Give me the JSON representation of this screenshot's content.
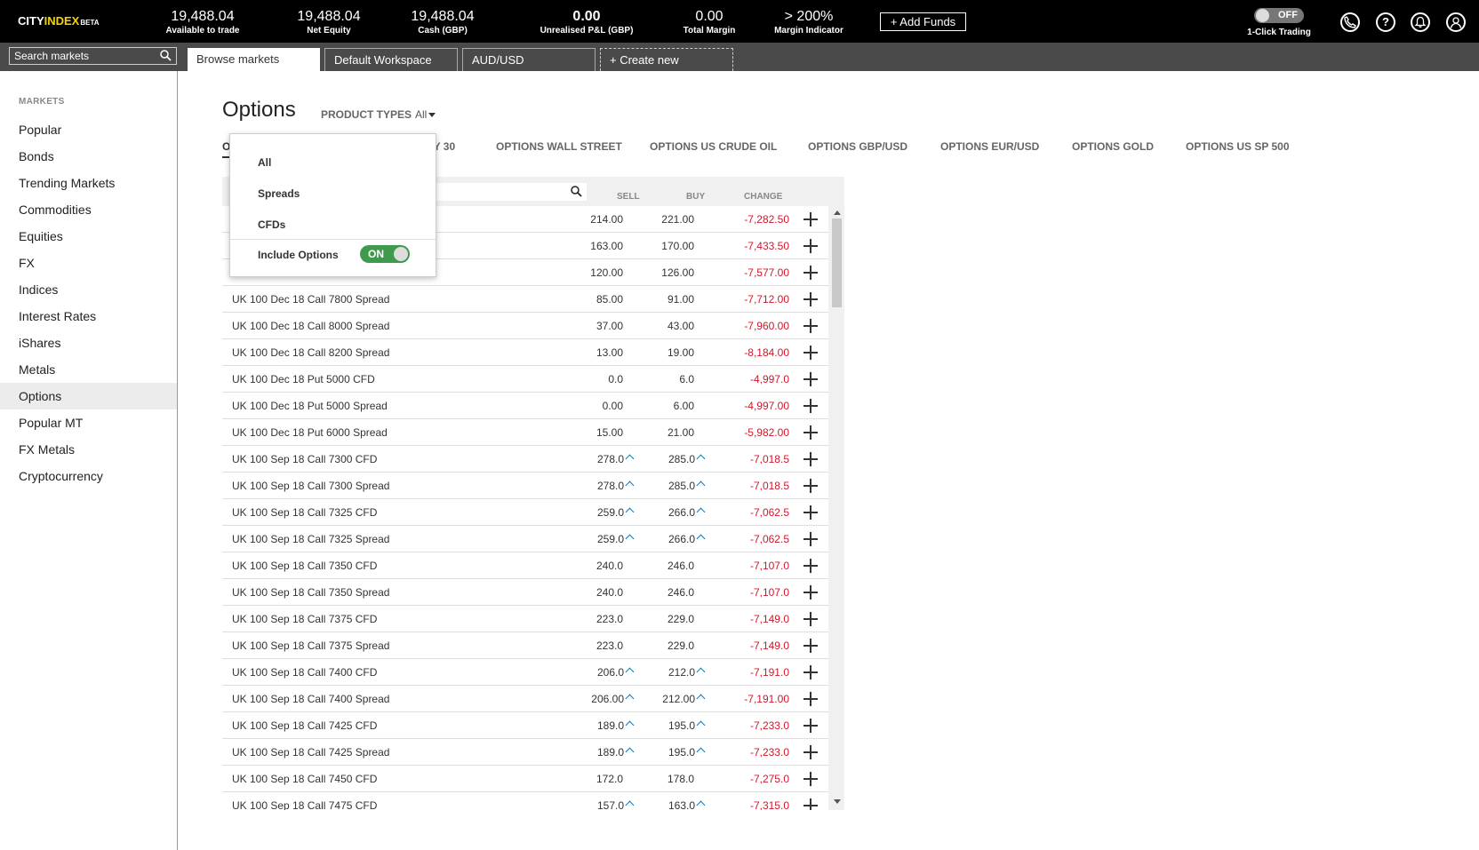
{
  "brand": {
    "part1": "CITY",
    "part2": "INDEX",
    "part3": "BETA"
  },
  "stats": [
    {
      "value": "19,488.04",
      "label": "Available to trade"
    },
    {
      "value": "19,488.04",
      "label": "Net Equity"
    },
    {
      "value": "19,488.04",
      "label": "Cash (GBP)"
    },
    {
      "value": "0.00",
      "label": "Unrealised P&L (GBP)"
    },
    {
      "value": "0.00",
      "label": "Total Margin"
    },
    {
      "value": "> 200%",
      "label": "Margin Indicator"
    }
  ],
  "add_funds_label": "+ Add Funds",
  "one_click": {
    "state": "OFF",
    "label": "1-Click Trading"
  },
  "top_icons": [
    "phone-icon",
    "help-icon",
    "bell-icon",
    "user-icon"
  ],
  "search": {
    "placeholder": "Search markets"
  },
  "workspace_tabs": [
    "Browse markets",
    "Default Workspace",
    "AUD/USD",
    "+ Create new"
  ],
  "sidebar": {
    "header": "MARKETS",
    "items": [
      "Popular",
      "Bonds",
      "Trending Markets",
      "Commodities",
      "Equities",
      "FX",
      "Indices",
      "Interest Rates",
      "iShares",
      "Metals",
      "Options",
      "Popular MT",
      "FX Metals",
      "Cryptocurrency"
    ],
    "active": "Options"
  },
  "main": {
    "title": "Options",
    "product_types_label": "PRODUCT TYPES",
    "product_types_value": "All",
    "category_tabs": [
      "O",
      "NY 30",
      "OPTIONS WALL STREET",
      "OPTIONS US CRUDE OIL",
      "OPTIONS GBP/USD",
      "OPTIONS EUR/USD",
      "OPTIONS GOLD",
      "OPTIONS US SP 500"
    ]
  },
  "dropdown": {
    "items": [
      "All",
      "Spreads",
      "CFDs"
    ],
    "include_options_label": "Include Options",
    "include_options_state": "ON"
  },
  "table": {
    "headers": {
      "sell": "SELL",
      "buy": "BUY",
      "change": "CHANGE"
    },
    "rows": [
      {
        "name": "",
        "sell": "214.00",
        "buy": "221.00",
        "change": "-7,282.50",
        "up": false
      },
      {
        "name": "",
        "sell": "163.00",
        "buy": "170.00",
        "change": "-7,433.50",
        "up": false
      },
      {
        "name": "",
        "sell": "120.00",
        "buy": "126.00",
        "change": "-7,577.00",
        "up": false
      },
      {
        "name": "UK 100 Dec 18 Call 7800 Spread",
        "sell": "85.00",
        "buy": "91.00",
        "change": "-7,712.00",
        "up": false
      },
      {
        "name": "UK 100 Dec 18 Call 8000 Spread",
        "sell": "37.00",
        "buy": "43.00",
        "change": "-7,960.00",
        "up": false
      },
      {
        "name": "UK 100 Dec 18 Call 8200 Spread",
        "sell": "13.00",
        "buy": "19.00",
        "change": "-8,184.00",
        "up": false
      },
      {
        "name": "UK 100 Dec 18 Put 5000 CFD",
        "sell": "0.0",
        "buy": "6.0",
        "change": "-4,997.0",
        "up": false
      },
      {
        "name": "UK 100 Dec 18 Put 5000 Spread",
        "sell": "0.00",
        "buy": "6.00",
        "change": "-4,997.00",
        "up": false
      },
      {
        "name": "UK 100 Dec 18 Put 6000 Spread",
        "sell": "15.00",
        "buy": "21.00",
        "change": "-5,982.00",
        "up": false
      },
      {
        "name": "UK 100 Sep 18 Call 7300 CFD",
        "sell": "278.0",
        "buy": "285.0",
        "change": "-7,018.5",
        "up": true
      },
      {
        "name": "UK 100 Sep 18 Call 7300 Spread",
        "sell": "278.0",
        "buy": "285.0",
        "change": "-7,018.5",
        "up": true
      },
      {
        "name": "UK 100 Sep 18 Call 7325 CFD",
        "sell": "259.0",
        "buy": "266.0",
        "change": "-7,062.5",
        "up": true
      },
      {
        "name": "UK 100 Sep 18 Call 7325 Spread",
        "sell": "259.0",
        "buy": "266.0",
        "change": "-7,062.5",
        "up": true
      },
      {
        "name": "UK 100 Sep 18 Call 7350 CFD",
        "sell": "240.0",
        "buy": "246.0",
        "change": "-7,107.0",
        "up": false
      },
      {
        "name": "UK 100 Sep 18 Call 7350 Spread",
        "sell": "240.0",
        "buy": "246.0",
        "change": "-7,107.0",
        "up": false
      },
      {
        "name": "UK 100 Sep 18 Call 7375 CFD",
        "sell": "223.0",
        "buy": "229.0",
        "change": "-7,149.0",
        "up": false
      },
      {
        "name": "UK 100 Sep 18 Call 7375 Spread",
        "sell": "223.0",
        "buy": "229.0",
        "change": "-7,149.0",
        "up": false
      },
      {
        "name": "UK 100 Sep 18 Call 7400 CFD",
        "sell": "206.0",
        "buy": "212.0",
        "change": "-7,191.0",
        "up": true
      },
      {
        "name": "UK 100 Sep 18 Call 7400 Spread",
        "sell": "206.00",
        "buy": "212.00",
        "change": "-7,191.00",
        "up": true
      },
      {
        "name": "UK 100 Sep 18 Call 7425 CFD",
        "sell": "189.0",
        "buy": "195.0",
        "change": "-7,233.0",
        "up": true
      },
      {
        "name": "UK 100 Sep 18 Call 7425 Spread",
        "sell": "189.0",
        "buy": "195.0",
        "change": "-7,233.0",
        "up": true
      },
      {
        "name": "UK 100 Sep 18 Call 7450 CFD",
        "sell": "172.0",
        "buy": "178.0",
        "change": "-7,275.0",
        "up": false
      },
      {
        "name": "UK 100 Sep 18 Call 7475 CFD",
        "sell": "157.0",
        "buy": "163.0",
        "change": "-7,315.0",
        "up": true
      }
    ]
  },
  "colors": {
    "accent_yellow": "#f5d400",
    "negative": "#d0182c",
    "toggle_on": "#3f9a4d",
    "arrow_up": "#1a73b0"
  }
}
